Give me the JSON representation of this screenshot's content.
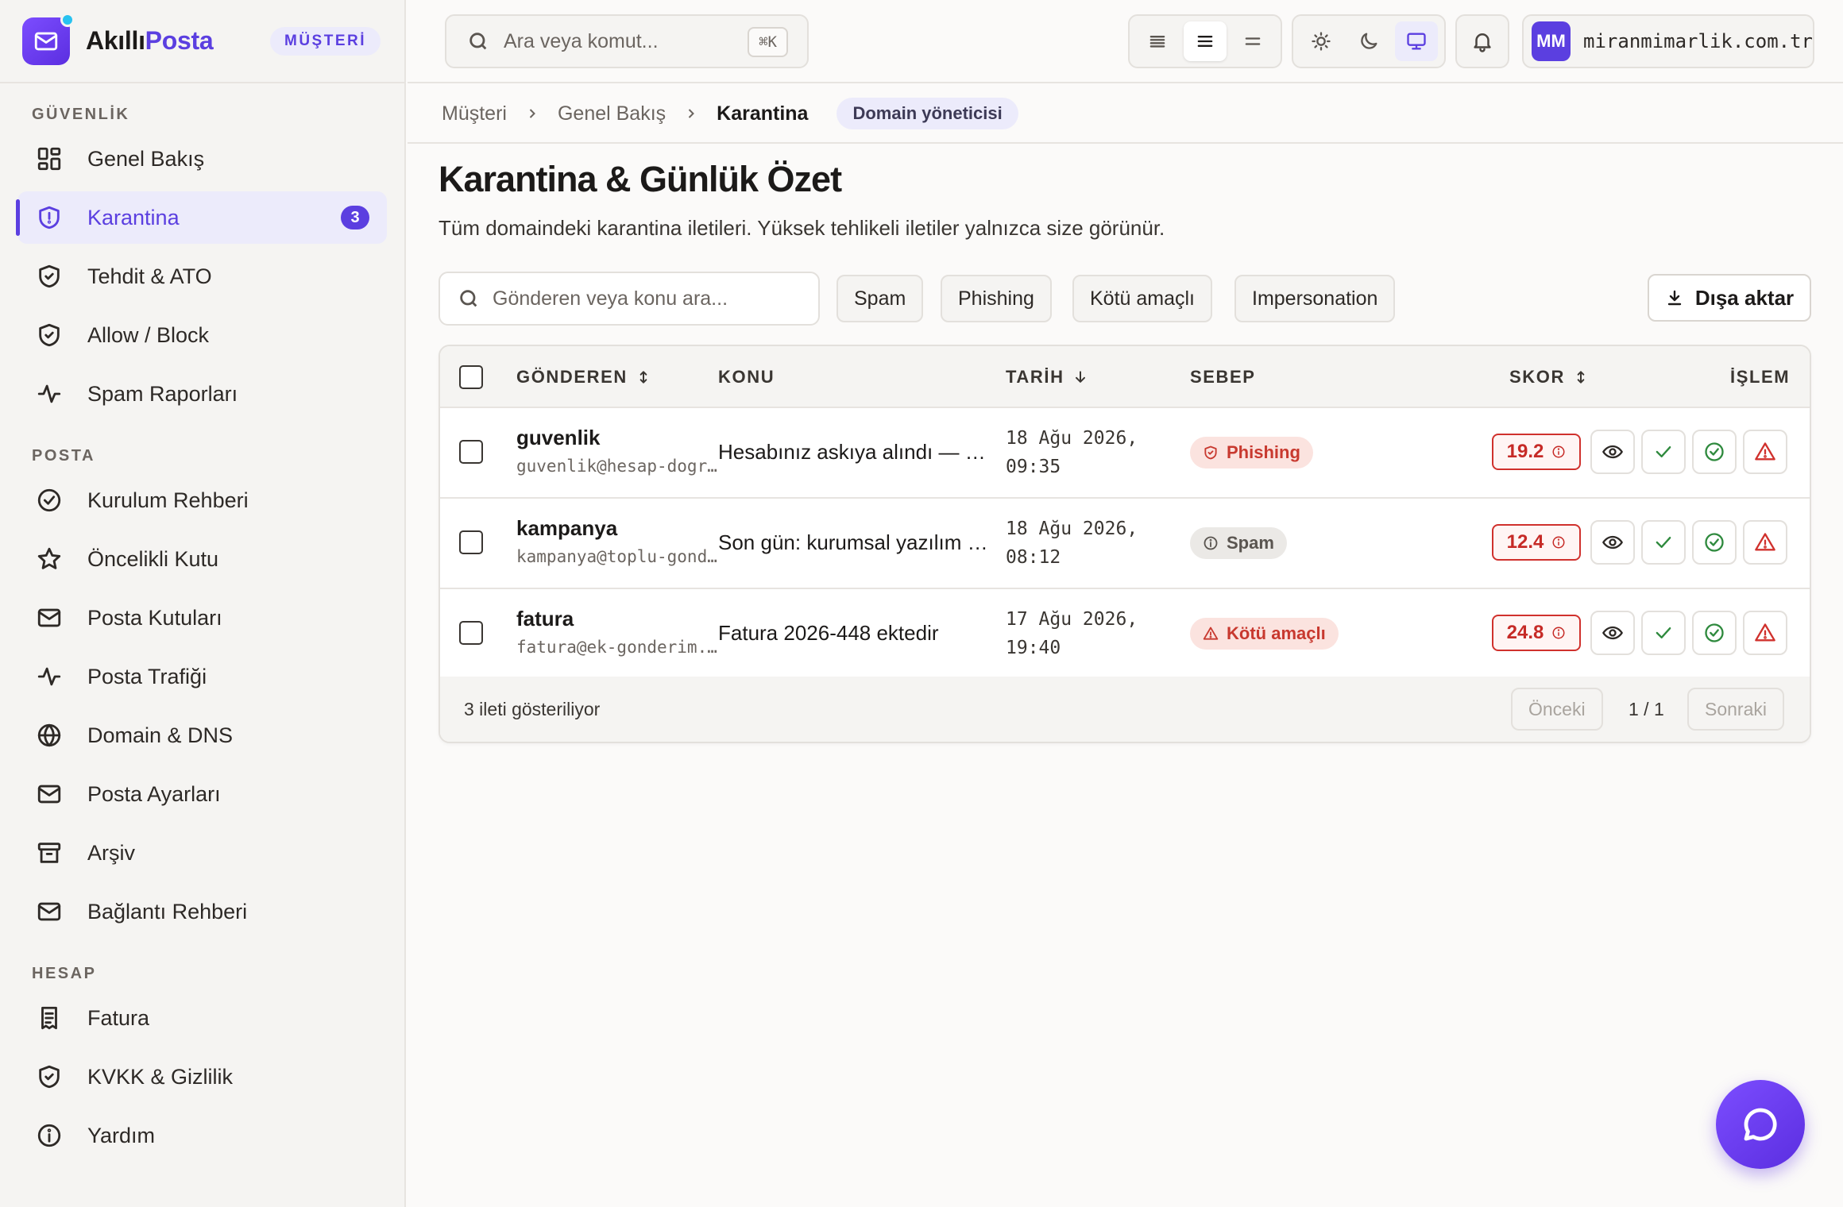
{
  "brand": {
    "name_part1": "Akıllı",
    "name_part2": "Posta",
    "role": "MÜŞTERİ"
  },
  "sidebar": {
    "sections": [
      {
        "title": "GÜVENLİK",
        "items": [
          {
            "label": "Genel Bakış",
            "icon": "dashboard-icon"
          },
          {
            "label": "Karantina",
            "icon": "shield-icon",
            "badge": "3",
            "active": true
          },
          {
            "label": "Tehdit & ATO",
            "icon": "shield-check-icon"
          },
          {
            "label": "Allow / Block",
            "icon": "shield-check-icon"
          },
          {
            "label": "Spam Raporları",
            "icon": "activity-icon"
          }
        ]
      },
      {
        "title": "POSTA",
        "items": [
          {
            "label": "Kurulum Rehberi",
            "icon": "check-circle-icon"
          },
          {
            "label": "Öncelikli Kutu",
            "icon": "star-icon"
          },
          {
            "label": "Posta Kutuları",
            "icon": "mail-icon"
          },
          {
            "label": "Posta Trafiği",
            "icon": "activity-icon"
          },
          {
            "label": "Domain & DNS",
            "icon": "globe-icon"
          },
          {
            "label": "Posta Ayarları",
            "icon": "mail-icon"
          },
          {
            "label": "Arşiv",
            "icon": "archive-icon"
          },
          {
            "label": "Bağlantı Rehberi",
            "icon": "mail-icon"
          }
        ]
      },
      {
        "title": "HESAP",
        "items": [
          {
            "label": "Fatura",
            "icon": "receipt-icon"
          },
          {
            "label": "KVKK & Gizlilik",
            "icon": "shield-check-icon"
          },
          {
            "label": "Yardım",
            "icon": "info-icon"
          }
        ]
      }
    ]
  },
  "topbar": {
    "search_placeholder": "Ara veya komut...",
    "shortcut": "⌘K",
    "account_initials": "MM",
    "account_domain": "miranmimarlik.com.tr"
  },
  "breadcrumb": {
    "items": [
      "Müşteri",
      "Genel Bakış"
    ],
    "current": "Karantina",
    "role": "Domain yöneticisi"
  },
  "page": {
    "title": "Karantina & Günlük Özet",
    "subtitle": "Tüm domaindeki karantina iletileri. Yüksek tehlikeli iletiler yalnızca size görünür."
  },
  "filters": {
    "search_placeholder": "Gönderen veya konu ara...",
    "chips": [
      "Spam",
      "Phishing",
      "Kötü amaçlı",
      "Impersonation"
    ],
    "export_label": "Dışa aktar"
  },
  "table": {
    "headers": {
      "sender": "GÖNDEREN",
      "subject": "KONU",
      "date": "TARİH",
      "reason": "SEBEP",
      "score": "SKOR",
      "action": "İŞLEM"
    },
    "rows": [
      {
        "name": "guvenlik",
        "email": "guvenlik@hesap-dogrulama.net",
        "subject": "Hesabınız askıya alındı — hemen doğrulayın",
        "date1": "18 Ağu 2026,",
        "date2": "09:35",
        "reason": "Phishing",
        "reason_type": "phishing",
        "score": "19.2"
      },
      {
        "name": "kampanya",
        "email": "kampanya@toplu-gonderim.com",
        "subject": "Son gün: kurumsal yazılım lisanslarında indirim",
        "date1": "18 Ağu 2026,",
        "date2": "08:12",
        "reason": "Spam",
        "reason_type": "spam",
        "score": "12.4"
      },
      {
        "name": "fatura",
        "email": "fatura@ek-gonderim.biz",
        "subject": "Fatura 2026-448 ektedir",
        "date1": "17 Ağu 2026,",
        "date2": "19:40",
        "reason": "Kötü amaçlı",
        "reason_type": "malware",
        "score": "24.8"
      }
    ],
    "footer": {
      "count_text": "3 ileti gösteriliyor",
      "prev": "Önceki",
      "page": "1 / 1",
      "next": "Sonraki"
    }
  },
  "colors": {
    "accent": "#5b3fe0",
    "danger": "#c62a26",
    "success": "#2f8a3e"
  }
}
